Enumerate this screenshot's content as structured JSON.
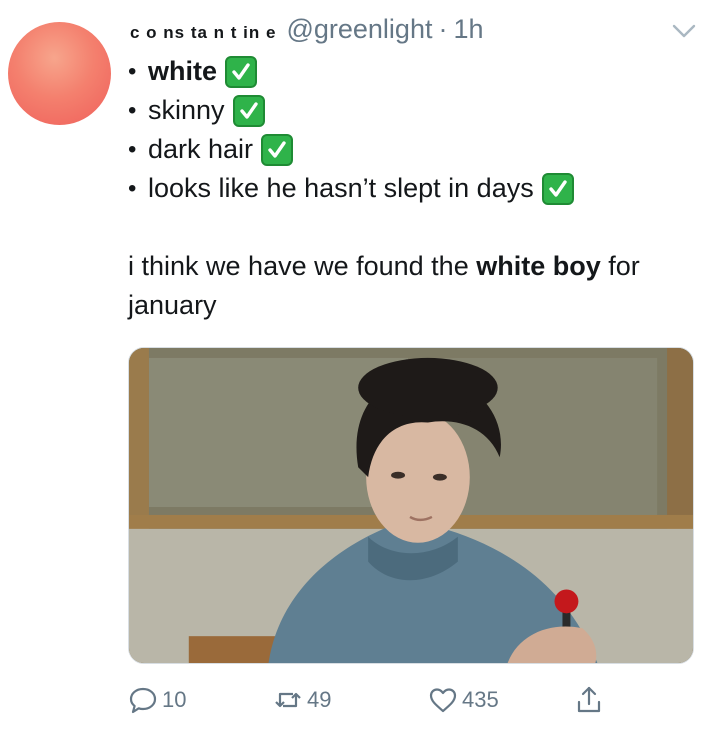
{
  "tweet": {
    "display_name": "c o ns ta n t in e",
    "handle": "@greenlight",
    "separator": "·",
    "time": "1h",
    "bullets": [
      {
        "text": "white",
        "bold": true
      },
      {
        "text": "skinny",
        "bold": false
      },
      {
        "text": "dark hair",
        "bold": false
      },
      {
        "text": "looks like he hasn’t slept in days",
        "bold": false
      }
    ],
    "paragraph": {
      "part1": "i think we have we found the ",
      "bold_part": "white boy",
      "part2": " for january"
    }
  },
  "actions": {
    "reply_count": "10",
    "retweet_count": "49",
    "like_count": "435"
  },
  "icons": {
    "check": "white-heavy-check-mark-icon",
    "reply": "reply-icon",
    "retweet": "retweet-icon",
    "like": "heart-icon",
    "share": "share-icon",
    "more": "chevron-down-icon"
  },
  "colors": {
    "secondary_text": "#657786",
    "check_green": "#2fb34a",
    "avatar": "#f4806e"
  }
}
